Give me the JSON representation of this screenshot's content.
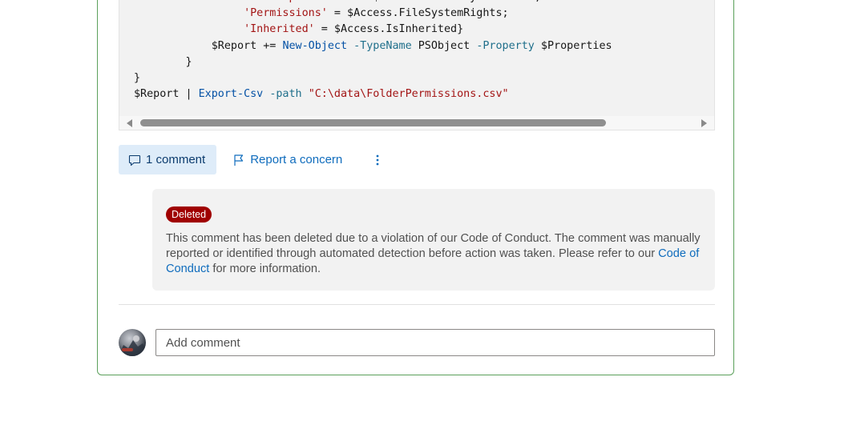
{
  "code": {
    "lines": [
      [
        {
          "t": "                 ",
          "c": "plain"
        },
        {
          "t": "'ADGroup or User'",
          "c": "str"
        },
        {
          "t": " = $Access.IdentityReference;",
          "c": "plain"
        }
      ],
      [
        {
          "t": "                 ",
          "c": "plain"
        },
        {
          "t": "'Permissions'",
          "c": "str"
        },
        {
          "t": " = $Access.FileSystemRights;",
          "c": "plain"
        }
      ],
      [
        {
          "t": "                 ",
          "c": "plain"
        },
        {
          "t": "'Inherited'",
          "c": "str"
        },
        {
          "t": " = $Access.IsInherited}",
          "c": "plain"
        }
      ],
      [
        {
          "t": "            $Report += ",
          "c": "plain"
        },
        {
          "t": "New-Object",
          "c": "cmd"
        },
        {
          "t": " ",
          "c": "plain"
        },
        {
          "t": "-TypeName",
          "c": "param"
        },
        {
          "t": " PSObject ",
          "c": "plain"
        },
        {
          "t": "-Property",
          "c": "param"
        },
        {
          "t": " $Properties",
          "c": "plain"
        }
      ],
      [
        {
          "t": "        }",
          "c": "plain"
        }
      ],
      [
        {
          "t": "}",
          "c": "plain"
        }
      ],
      [
        {
          "t": "$Report | ",
          "c": "plain"
        },
        {
          "t": "Export-Csv",
          "c": "cmd"
        },
        {
          "t": " ",
          "c": "plain"
        },
        {
          "t": "-path",
          "c": "param"
        },
        {
          "t": " ",
          "c": "plain"
        },
        {
          "t": "\"C:\\data\\FolderPermissions.csv\"",
          "c": "str"
        }
      ]
    ]
  },
  "actions": {
    "comment_label": "1 comment",
    "concern_label": "Report a concern"
  },
  "deleted": {
    "badge": "Deleted",
    "message_before": "This comment has been deleted due to a violation of our Code of Conduct. The comment was manually reported or identified through automated detection before action was taken. Please refer to our ",
    "link_text": "Code of Conduct",
    "message_after": " for more information."
  },
  "composer": {
    "placeholder": "Add comment"
  },
  "colors": {
    "card_border": "#5ba05b",
    "badge_bg": "#a00000",
    "link": "#0f6cbd",
    "comment_btn_bg": "#deecf9"
  }
}
